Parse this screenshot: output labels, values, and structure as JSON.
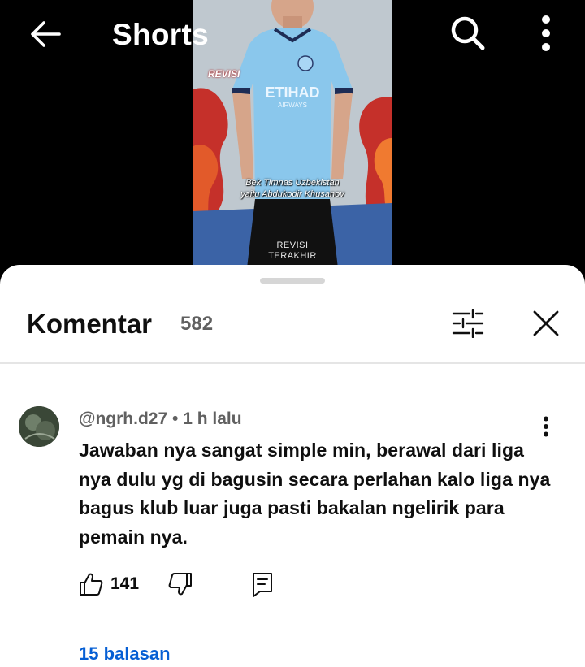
{
  "header": {
    "title": "Shorts",
    "back_icon": "arrow-left-icon",
    "search_icon": "search-icon",
    "more_icon": "more-vertical-icon"
  },
  "video": {
    "caption_line1": "Bek Timnas Uzbekistan",
    "caption_line2": "yaitu Abdukodir Khusanov",
    "watermark_top": "REVISI",
    "watermark_bottom_line1": "REVISI",
    "watermark_bottom_line2": "TERAKHIR",
    "jersey_text": "ETIHAD AIRWAYS"
  },
  "comments_panel": {
    "title": "Komentar",
    "count": "582",
    "filter_icon": "sliders-icon",
    "close_icon": "close-icon"
  },
  "comment": {
    "author": "@ngrh.d27",
    "separator": "•",
    "time": "1 h lalu",
    "text": "Jawaban nya sangat simple min, berawal dari liga nya dulu yg di bagusin secara perlahan kalo liga nya bagus klub luar juga pasti bakalan ngelirik para pemain nya.",
    "likes": "141",
    "replies_label": "15 balasan"
  },
  "colors": {
    "link": "#065fd4",
    "secondary_text": "#606060",
    "primary_text": "#0f0f0f"
  }
}
